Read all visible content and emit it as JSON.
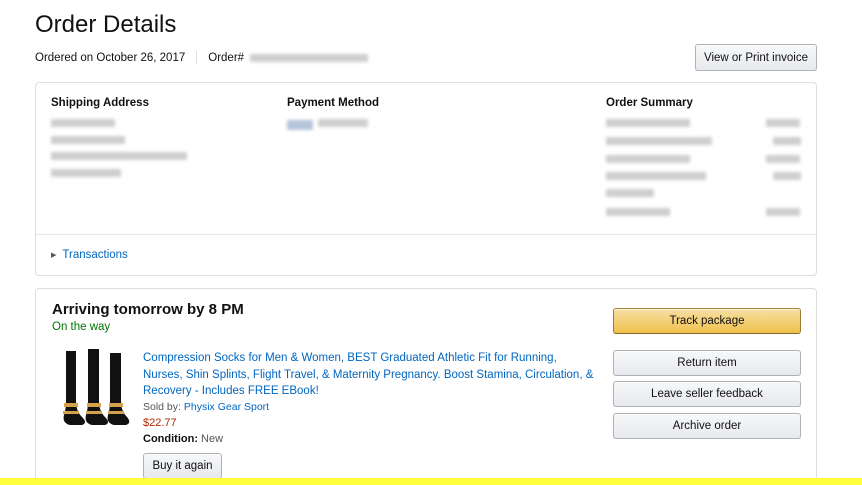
{
  "page": {
    "title": "Order Details",
    "ordered_on": "Ordered on October 26, 2017",
    "order_label": "Order#",
    "view_invoice": "View or Print invoice"
  },
  "summary_box": {
    "shipping_address": "Shipping Address",
    "payment_method": "Payment Method",
    "order_summary": "Order Summary",
    "transactions": "Transactions"
  },
  "shipment": {
    "arriving": "Arriving tomorrow by 8 PM",
    "status": "On the way",
    "product_title": "Compression Socks for Men & Women, BEST Graduated Athletic Fit for Running, Nurses, Shin Splints, Flight Travel, & Maternity Pregnancy. Boost Stamina, Circulation, & Recovery - Includes FREE EBook!",
    "sold_by_label": "Sold by:",
    "seller": "Physix Gear Sport",
    "price": "$22.77",
    "condition_label": "Condition:",
    "condition_value": "New",
    "buy_again": "Buy it again"
  },
  "actions": {
    "track": "Track package",
    "return": "Return item",
    "feedback": "Leave seller feedback",
    "archive": "Archive order"
  },
  "colors": {
    "link": "#0066c0",
    "status_green": "#007600",
    "price_red": "#b12704",
    "track_button": "#f0c14b",
    "highlight_strip": "#ffff3b"
  }
}
